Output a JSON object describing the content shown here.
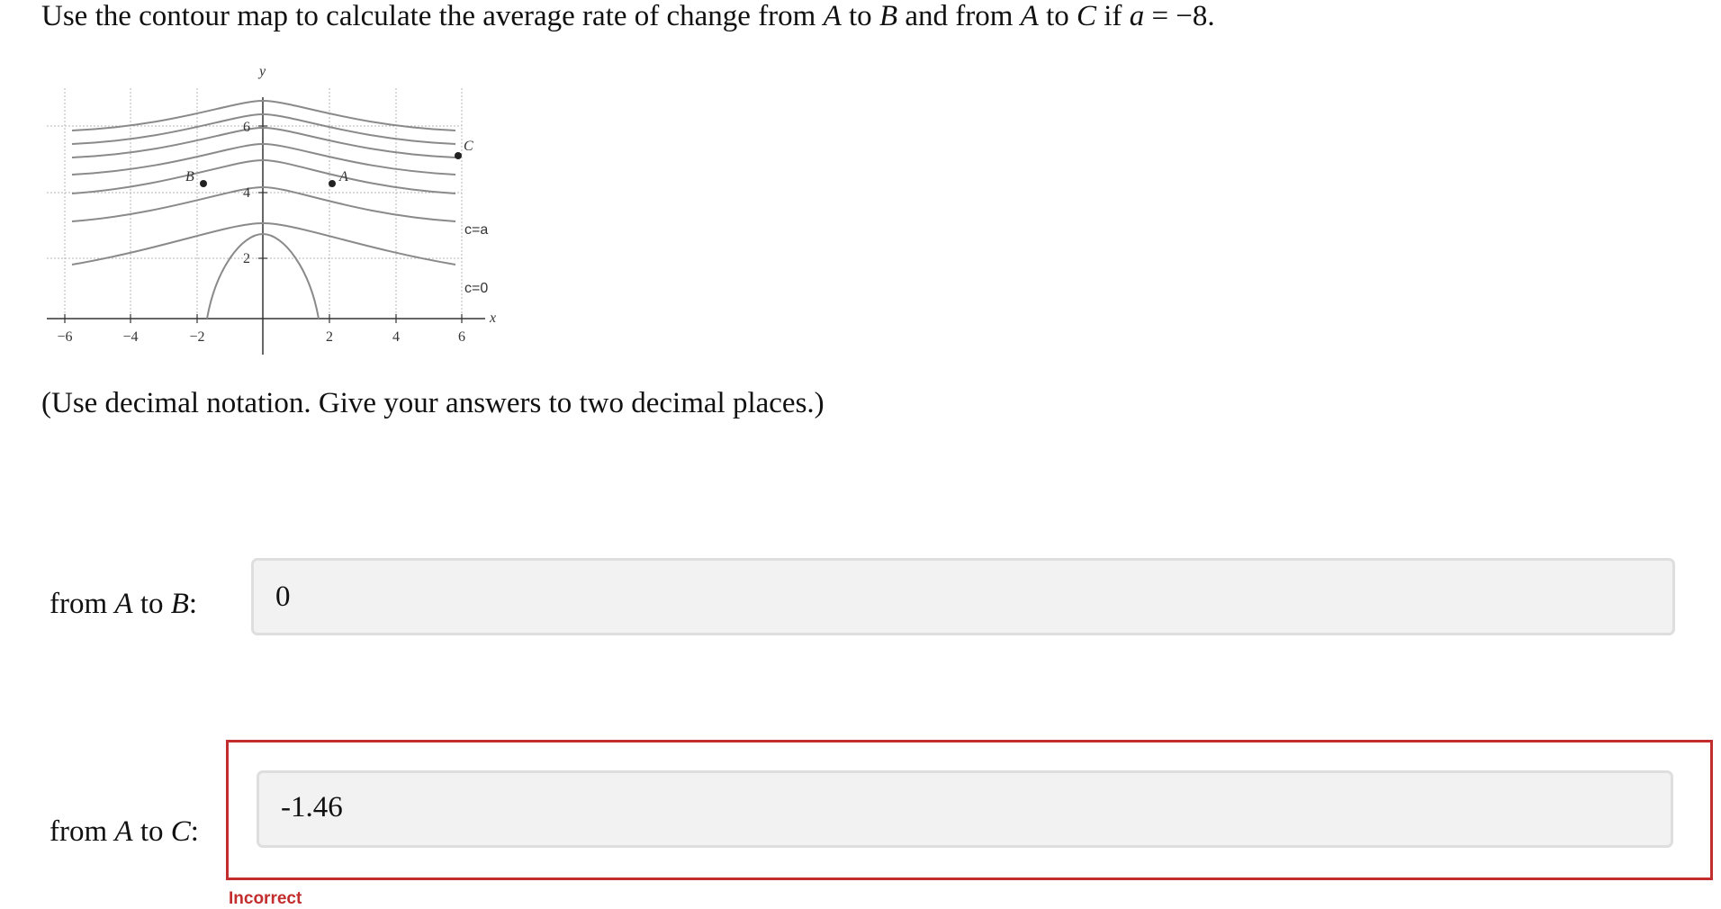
{
  "question": {
    "part1": "Use the contour map to calculate the average rate of change from ",
    "A": "A",
    "part2": " to ",
    "B": "B",
    "part3": " and from ",
    "C": "C",
    "part4": " if ",
    "var": "a",
    "part5": " = −8."
  },
  "instruction": "(Use decimal notation. Give your answers to two decimal places.)",
  "plot": {
    "x_label": "x",
    "y_label": "y",
    "x_ticks": [
      "−6",
      "−4",
      "−2",
      "2",
      "4",
      "6"
    ],
    "y_ticks": [
      "2",
      "4",
      "6"
    ],
    "points": [
      "A",
      "B",
      "C"
    ],
    "contour_labels": [
      "c=a",
      "c=0"
    ]
  },
  "answers": [
    {
      "label_from": "from ",
      "label_p1": "A",
      "label_to": " to ",
      "label_p2": "B",
      "label_colon": ":",
      "value": "0"
    },
    {
      "label_from": "from ",
      "label_p1": "A",
      "label_to": " to ",
      "label_p2": "C",
      "label_colon": ":",
      "value": "-1.46",
      "feedback": "Incorrect"
    }
  ],
  "colors": {
    "error": "#c32d2d",
    "field_bg": "#f2f2f2",
    "contour": "#8a8a8a"
  }
}
